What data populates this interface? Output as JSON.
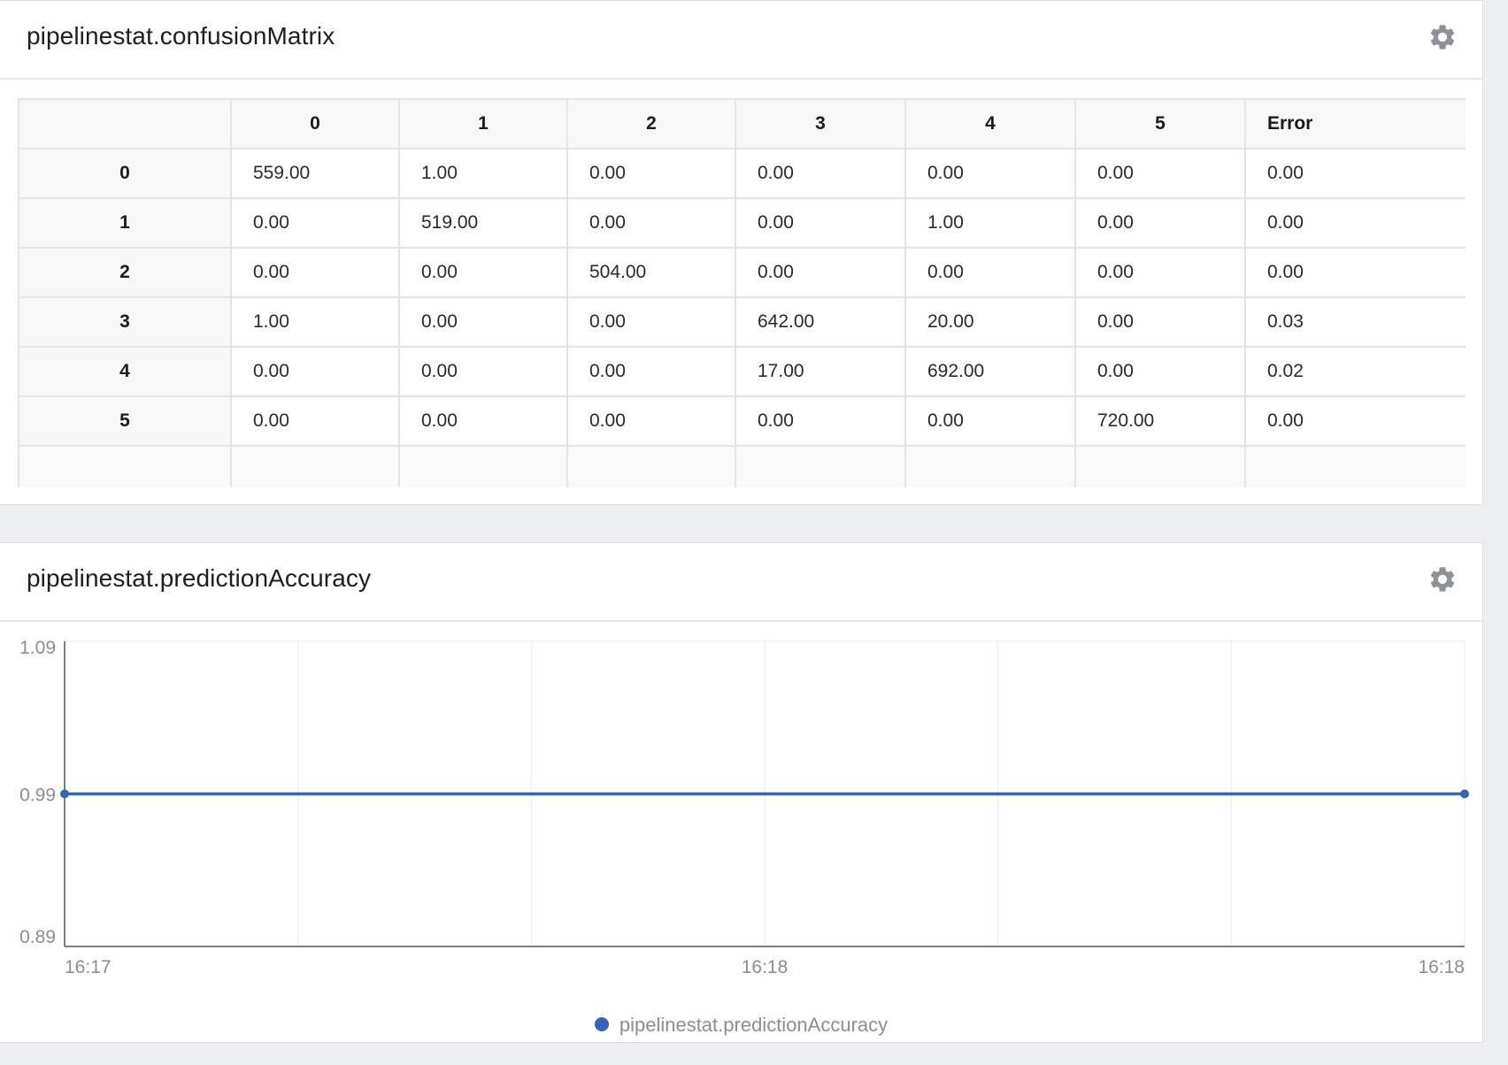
{
  "panels": {
    "confusion": {
      "title": "pipelinestat.confusionMatrix",
      "columns": [
        "",
        "0",
        "1",
        "2",
        "3",
        "4",
        "5",
        "Error"
      ],
      "rows": [
        {
          "label": "0",
          "cells": [
            "559.00",
            "1.00",
            "0.00",
            "0.00",
            "0.00",
            "0.00",
            "0.00"
          ]
        },
        {
          "label": "1",
          "cells": [
            "0.00",
            "519.00",
            "0.00",
            "0.00",
            "1.00",
            "0.00",
            "0.00"
          ]
        },
        {
          "label": "2",
          "cells": [
            "0.00",
            "0.00",
            "504.00",
            "0.00",
            "0.00",
            "0.00",
            "0.00"
          ]
        },
        {
          "label": "3",
          "cells": [
            "1.00",
            "0.00",
            "0.00",
            "642.00",
            "20.00",
            "0.00",
            "0.03"
          ]
        },
        {
          "label": "4",
          "cells": [
            "0.00",
            "0.00",
            "0.00",
            "17.00",
            "692.00",
            "0.00",
            "0.02"
          ]
        },
        {
          "label": "5",
          "cells": [
            "0.00",
            "0.00",
            "0.00",
            "0.00",
            "0.00",
            "720.00",
            "0.00"
          ]
        }
      ]
    },
    "accuracy": {
      "title": "pipelinestat.predictionAccuracy"
    }
  },
  "icons": {
    "settings": "gear-icon"
  },
  "colors": {
    "series": "#3565b4",
    "grid": "#eeeeee",
    "axis": "#555555"
  },
  "chart_data": {
    "type": "line",
    "title": "",
    "xlabel": "",
    "ylabel": "",
    "yticks": [
      "1.09",
      "0.99",
      "0.89"
    ],
    "ylim": [
      0.89,
      1.09
    ],
    "xticks": [
      "16:17",
      "16:18",
      "16:18"
    ],
    "series": [
      {
        "name": "pipelinestat.predictionAccuracy",
        "values": [
          0.99,
          0.99
        ]
      }
    ],
    "grid": true,
    "legend": "bottom-center"
  }
}
